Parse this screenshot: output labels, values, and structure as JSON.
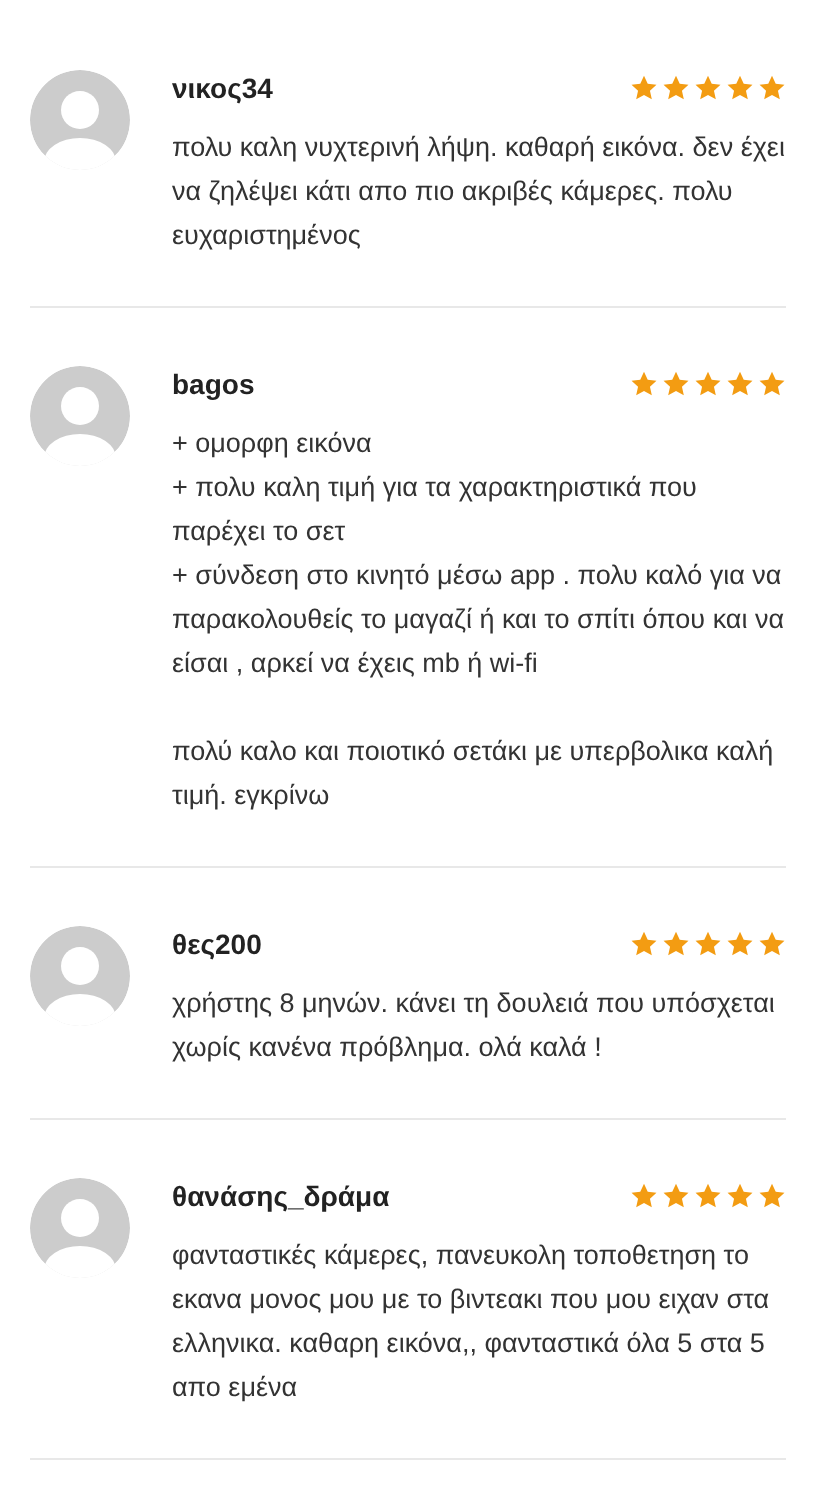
{
  "reviews": [
    {
      "author": "νικος34",
      "stars": 5,
      "paragraphs": [
        [
          "πολυ καλη νυχτερινή λήψη. καθαρή εικόνα. δεν έχει να ζηλέψει κάτι απο πιο ακριβές κάμερες. πολυ ευχαριστημένος"
        ]
      ]
    },
    {
      "author": "bagos",
      "stars": 5,
      "paragraphs": [
        [
          "+ ομορφη εικόνα",
          "+ πολυ καλη τιμή για τα χαρακτηριστικά που παρέχει το σετ",
          "+ σύνδεση στο κινητό μέσω app . πολυ καλό για να παρακολουθείς το μαγαζί ή και το σπίτι όπου και να είσαι , αρκεί να έχεις mb ή wi-fi"
        ],
        [
          "πολύ καλο και ποιοτικό σετάκι με υπερβολικα καλή τιμή. εγκρίνω"
        ]
      ]
    },
    {
      "author": "θες200",
      "stars": 5,
      "paragraphs": [
        [
          "χρήστης 8 μηνών. κάνει τη δουλειά που υπόσχεται χωρίς κανένα πρόβλημα. ολά καλά !"
        ]
      ]
    },
    {
      "author": "θανάσης_δράμα",
      "stars": 5,
      "paragraphs": [
        [
          "φανταστικές κάμερες, πανευκολη τοποθετηση το εκανα μονος μου με το βιντεακι που μου ειχαν στα ελληνικα. καθαρη εικόνα,, φανταστικά όλα 5 στα 5 απο εμένα"
        ]
      ]
    }
  ]
}
